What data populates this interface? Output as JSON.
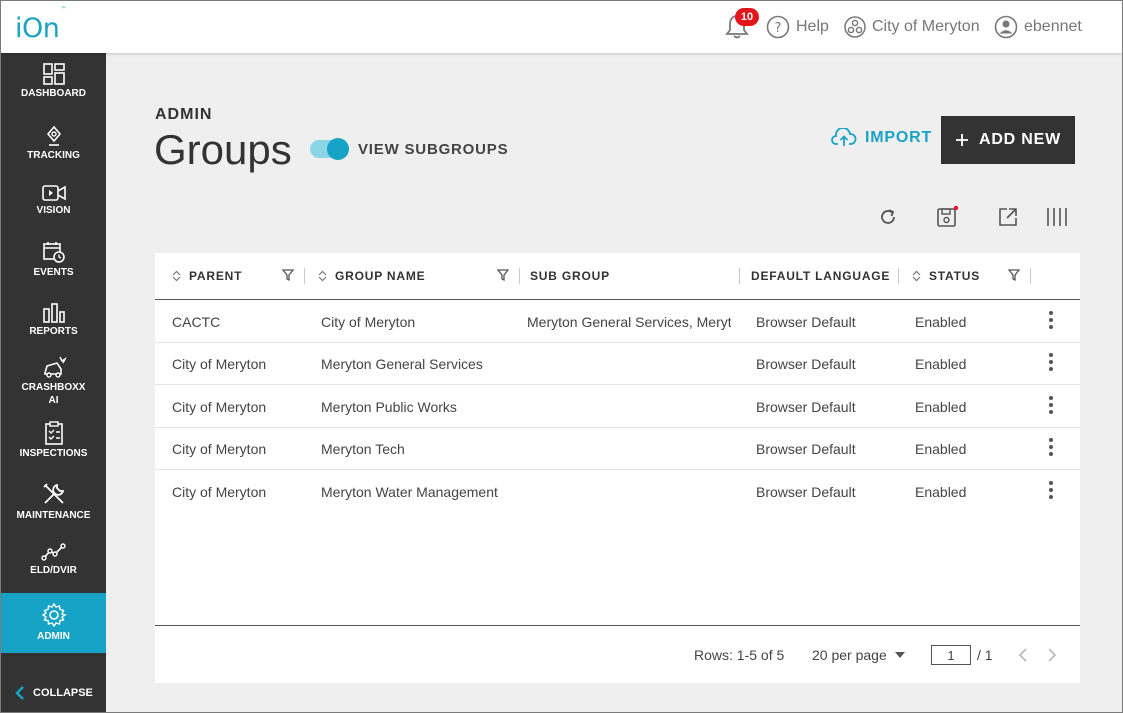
{
  "topbar": {
    "logo": "iOn",
    "logo_tm": "™",
    "notifications_count": "10",
    "help": "Help",
    "organization": "City of Meryton",
    "user": "ebennet"
  },
  "sidebar": {
    "items": [
      {
        "label": "DASHBOARD",
        "icon": "dashboard-icon"
      },
      {
        "label": "TRACKING",
        "icon": "location-pin-icon"
      },
      {
        "label": "VISION",
        "icon": "video-camera-icon"
      },
      {
        "label": "EVENTS",
        "icon": "calendar-clock-icon"
      },
      {
        "label": "REPORTS",
        "icon": "bar-chart-icon"
      },
      {
        "label": "CRASHBOXX AI",
        "icon": "crash-car-icon"
      },
      {
        "label": "INSPECTIONS",
        "icon": "clipboard-check-icon"
      },
      {
        "label": "MAINTENANCE",
        "icon": "wrench-screwdriver-icon"
      },
      {
        "label": "ELD/DVIR",
        "icon": "line-chart-icon"
      },
      {
        "label": "ADMIN",
        "icon": "gear-icon",
        "active": true
      }
    ],
    "collapse": "COLLAPSE"
  },
  "page": {
    "section": "ADMIN",
    "title": "Groups",
    "toggle_label": "VIEW SUBGROUPS",
    "toggle_on": true,
    "import": "IMPORT",
    "add_new": "ADD NEW",
    "accent": "#17a3c6",
    "dark": "#333333"
  },
  "table": {
    "headers": {
      "parent": "PARENT",
      "group_name": "GROUP NAME",
      "sub_group": "SUB GROUP",
      "default_language": "DEFAULT LANGUAGE",
      "status": "STATUS"
    },
    "rows": [
      {
        "parent": "CACTC",
        "group_name": "City of Meryton",
        "sub_group": "Meryton General Services, Meryto",
        "default_language": "Browser Default",
        "status": "Enabled"
      },
      {
        "parent": "City of Meryton",
        "group_name": "Meryton General Services",
        "sub_group": "",
        "default_language": "Browser Default",
        "status": "Enabled"
      },
      {
        "parent": "City of Meryton",
        "group_name": "Meryton Public Works",
        "sub_group": "",
        "default_language": "Browser Default",
        "status": "Enabled"
      },
      {
        "parent": "City of Meryton",
        "group_name": "Meryton Tech",
        "sub_group": "",
        "default_language": "Browser Default",
        "status": "Enabled"
      },
      {
        "parent": "City of Meryton",
        "group_name": "Meryton Water Management",
        "sub_group": "",
        "default_language": "Browser Default",
        "status": "Enabled"
      }
    ],
    "footer": {
      "rows_info": "Rows: 1-5 of 5",
      "per_page": "20 per page",
      "page_value": "1",
      "page_total": "/ 1"
    }
  }
}
